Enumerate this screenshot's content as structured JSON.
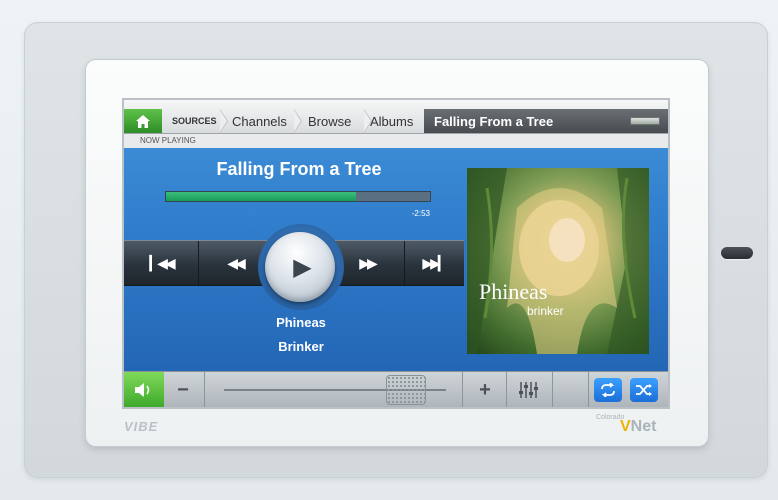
{
  "breadcrumb": {
    "home_label": "",
    "items": [
      "SOURCES",
      "Channels",
      "Browse",
      "Albums"
    ],
    "current": "Falling From a Tree"
  },
  "now_playing_label": "NOW PLAYING",
  "track": {
    "title": "Falling From a Tree",
    "remaining_time": "-2:53",
    "progress": 0.72,
    "artist": "Phineas",
    "album": "Brinker"
  },
  "album_art": {
    "title_text": "Phineas",
    "sub_text": "brinker"
  },
  "transport": {
    "prev_track": "▎◀◀",
    "rewind": "◀◀",
    "fast_forward": "▶▶",
    "next_track": "▶▶▎",
    "play": "▶"
  },
  "volume": {
    "minus": "−",
    "plus": "+",
    "level": 0.82
  },
  "branding": {
    "device": "VIBE",
    "maker_small": "Colorado",
    "maker_v": "V",
    "maker_net": "Net"
  },
  "icons": {
    "home": "home-icon",
    "menu": "menu-icon",
    "speaker": "speaker-icon",
    "equalizer": "equalizer-icon",
    "repeat": "repeat-icon",
    "shuffle": "shuffle-icon"
  },
  "colors": {
    "accent_green": "#2f8c27",
    "screen_blue": "#2b78c6",
    "progress_green": "#199a58",
    "toggle_blue": "#1b6fd6"
  }
}
